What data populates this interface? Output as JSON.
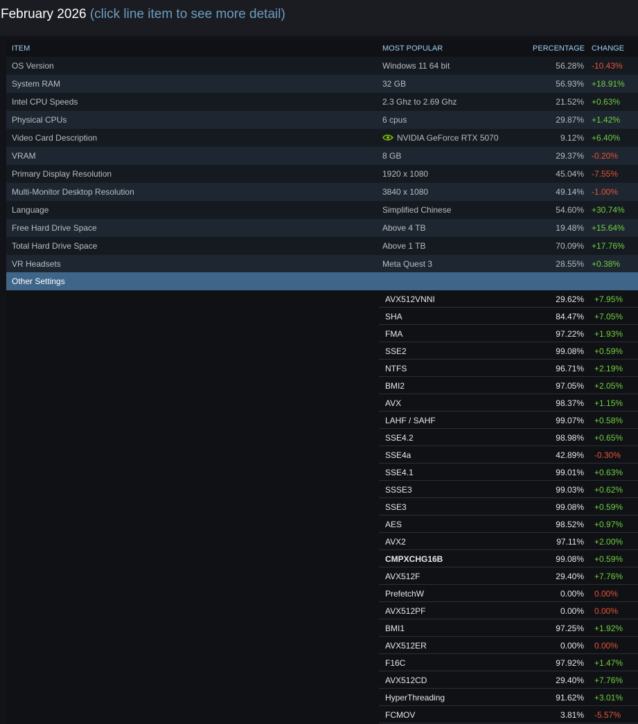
{
  "header": {
    "month": "February 2026",
    "hint": "(click line item to see more detail)"
  },
  "columns": {
    "item": "ITEM",
    "popular": "MOST POPULAR",
    "percentage": "PERCENTAGE",
    "change": "CHANGE"
  },
  "rows": [
    {
      "item": "OS Version",
      "popular": "Windows 11 64 bit",
      "percentage": "56.28%",
      "change": "-10.43%"
    },
    {
      "item": "System RAM",
      "popular": "32 GB",
      "percentage": "56.93%",
      "change": "+18.91%"
    },
    {
      "item": "Intel CPU Speeds",
      "popular": "2.3 Ghz to 2.69 Ghz",
      "percentage": "21.52%",
      "change": "+0.63%"
    },
    {
      "item": "Physical CPUs",
      "popular": "6 cpus",
      "percentage": "29.87%",
      "change": "+1.42%"
    },
    {
      "item": "Video Card Description",
      "popular": "NVIDIA GeForce RTX 5070",
      "percentage": "9.12%",
      "change": "+6.40%",
      "icon": "nvidia-logo-icon"
    },
    {
      "item": "VRAM",
      "popular": "8 GB",
      "percentage": "29.37%",
      "change": "-0.20%"
    },
    {
      "item": "Primary Display Resolution",
      "popular": "1920 x 1080",
      "percentage": "45.04%",
      "change": "-7.55%"
    },
    {
      "item": "Multi-Monitor Desktop Resolution",
      "popular": "3840 x 1080",
      "percentage": "49.14%",
      "change": "-1.00%"
    },
    {
      "item": "Language",
      "popular": "Simplified Chinese",
      "percentage": "54.60%",
      "change": "+30.74%"
    },
    {
      "item": "Free Hard Drive Space",
      "popular": "Above 4 TB",
      "percentage": "19.48%",
      "change": "+15.64%"
    },
    {
      "item": "Total Hard Drive Space",
      "popular": "Above 1 TB",
      "percentage": "70.09%",
      "change": "+17.76%"
    },
    {
      "item": "VR Headsets",
      "popular": "Meta Quest 3",
      "percentage": "28.55%",
      "change": "+0.38%"
    }
  ],
  "other_settings": {
    "label": "Other Settings",
    "items": [
      {
        "name": "AVX512VNNI",
        "percentage": "29.62%",
        "change": "+7.95%"
      },
      {
        "name": "SHA",
        "percentage": "84.47%",
        "change": "+7.05%"
      },
      {
        "name": "FMA",
        "percentage": "97.22%",
        "change": "+1.93%"
      },
      {
        "name": "SSE2",
        "percentage": "99.08%",
        "change": "+0.59%"
      },
      {
        "name": "NTFS",
        "percentage": "96.71%",
        "change": "+2.19%"
      },
      {
        "name": "BMI2",
        "percentage": "97.05%",
        "change": "+2.05%"
      },
      {
        "name": "AVX",
        "percentage": "98.37%",
        "change": "+1.15%"
      },
      {
        "name": "LAHF / SAHF",
        "percentage": "99.07%",
        "change": "+0.58%"
      },
      {
        "name": "SSE4.2",
        "percentage": "98.98%",
        "change": "+0.65%"
      },
      {
        "name": "SSE4a",
        "percentage": "42.89%",
        "change": "-0.30%"
      },
      {
        "name": "SSE4.1",
        "percentage": "99.01%",
        "change": "+0.63%"
      },
      {
        "name": "SSSE3",
        "percentage": "99.03%",
        "change": "+0.62%"
      },
      {
        "name": "SSE3",
        "percentage": "99.08%",
        "change": "+0.59%"
      },
      {
        "name": "AES",
        "percentage": "98.52%",
        "change": "+0.97%"
      },
      {
        "name": "AVX2",
        "percentage": "97.11%",
        "change": "+2.00%"
      },
      {
        "name": "CMPXCHG16B",
        "percentage": "99.08%",
        "change": "+0.59%",
        "bold": true
      },
      {
        "name": "AVX512F",
        "percentage": "29.40%",
        "change": "+7.76%"
      },
      {
        "name": "PrefetchW",
        "percentage": "0.00%",
        "change": "0.00%"
      },
      {
        "name": "AVX512PF",
        "percentage": "0.00%",
        "change": "0.00%"
      },
      {
        "name": "BMI1",
        "percentage": "97.25%",
        "change": "+1.92%"
      },
      {
        "name": "AVX512ER",
        "percentage": "0.00%",
        "change": "0.00%"
      },
      {
        "name": "F16C",
        "percentage": "97.92%",
        "change": "+1.47%"
      },
      {
        "name": "AVX512CD",
        "percentage": "29.40%",
        "change": "+7.76%"
      },
      {
        "name": "HyperThreading",
        "percentage": "91.62%",
        "change": "+3.01%"
      },
      {
        "name": "FCMOV",
        "percentage": "3.81%",
        "change": "-5.57%"
      }
    ]
  },
  "colors": {
    "positive": "#72d03e",
    "negative": "#e8533a",
    "header": "#9fd0f5",
    "other_settings_bg": "#3f6689"
  }
}
